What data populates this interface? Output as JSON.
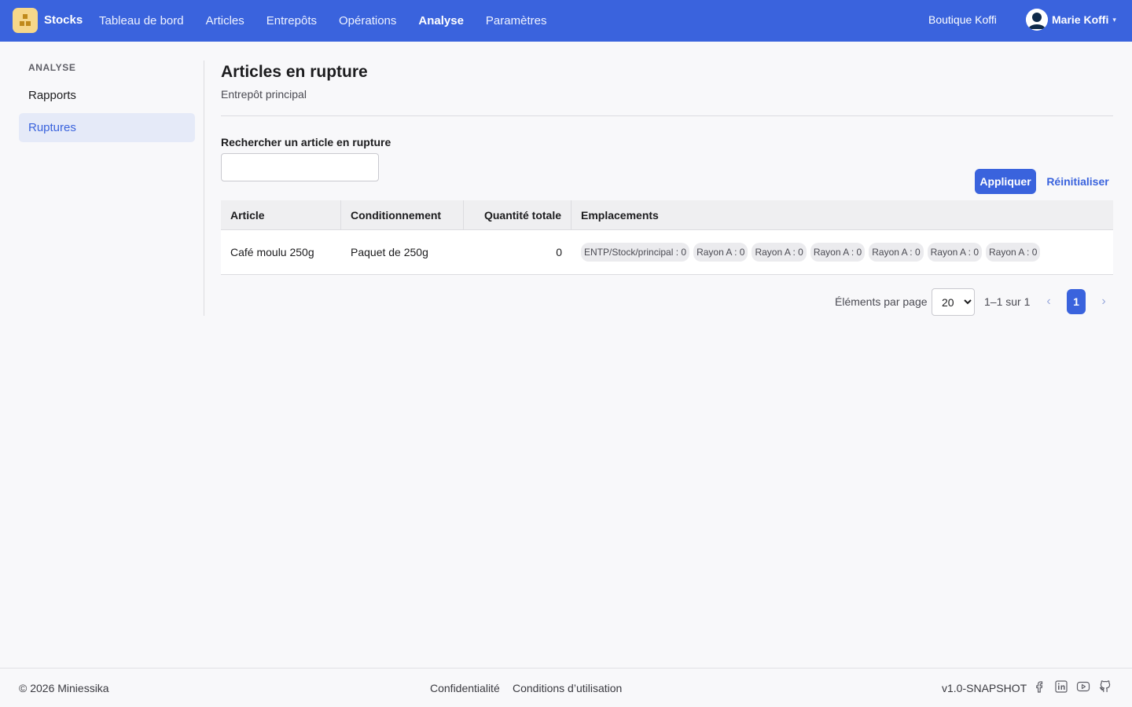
{
  "header": {
    "brand": "Stocks",
    "nav": [
      {
        "label": "Tableau de bord",
        "active": false
      },
      {
        "label": "Articles",
        "active": false
      },
      {
        "label": "Entrepôts",
        "active": false
      },
      {
        "label": "Opérations",
        "active": false
      },
      {
        "label": "Analyse",
        "active": true
      },
      {
        "label": "Paramètres",
        "active": false
      }
    ],
    "shop": "Boutique Koffi",
    "user": "Marie Koffi"
  },
  "sidebar": {
    "heading": "ANALYSE",
    "items": [
      {
        "label": "Rapports",
        "active": false
      },
      {
        "label": "Ruptures",
        "active": true
      }
    ]
  },
  "main": {
    "title": "Articles en rupture",
    "subtitle": "Entrepôt principal",
    "search": {
      "label": "Rechercher un article en rupture",
      "value": "",
      "placeholder": ""
    },
    "apply_label": "Appliquer",
    "reset_label": "Réinitialiser",
    "table": {
      "columns": [
        "Article",
        "Conditionnement",
        "Quantité totale",
        "Emplacements"
      ],
      "rows": [
        {
          "article": "Café moulu 250g",
          "packaging": "Paquet de 250g",
          "quantity": "0",
          "locations": [
            "ENTP/Stock/principal : 0",
            "Rayon A : 0",
            "Rayon A : 0",
            "Rayon A : 0",
            "Rayon A : 0",
            "Rayon A : 0",
            "Rayon A : 0"
          ]
        }
      ]
    },
    "pagination": {
      "per_page_label": "Éléments par page",
      "per_page_value": "20",
      "per_page_options": [
        "20"
      ],
      "range": "1–1 sur 1",
      "current_page": "1",
      "prev": "‹",
      "next": "›"
    }
  },
  "footer": {
    "copyright": "© 2026 Miniessika",
    "links": [
      "Confidentialité",
      "Conditions d’utilisation"
    ],
    "version": "v1.0-SNAPSHOT",
    "social": [
      "facebook-icon",
      "linkedin-icon",
      "youtube-icon",
      "github-icon"
    ]
  },
  "colors": {
    "accent": "#3a63dd",
    "logo_bg": "#f6d78a",
    "active_bg": "#e5eaf8"
  }
}
